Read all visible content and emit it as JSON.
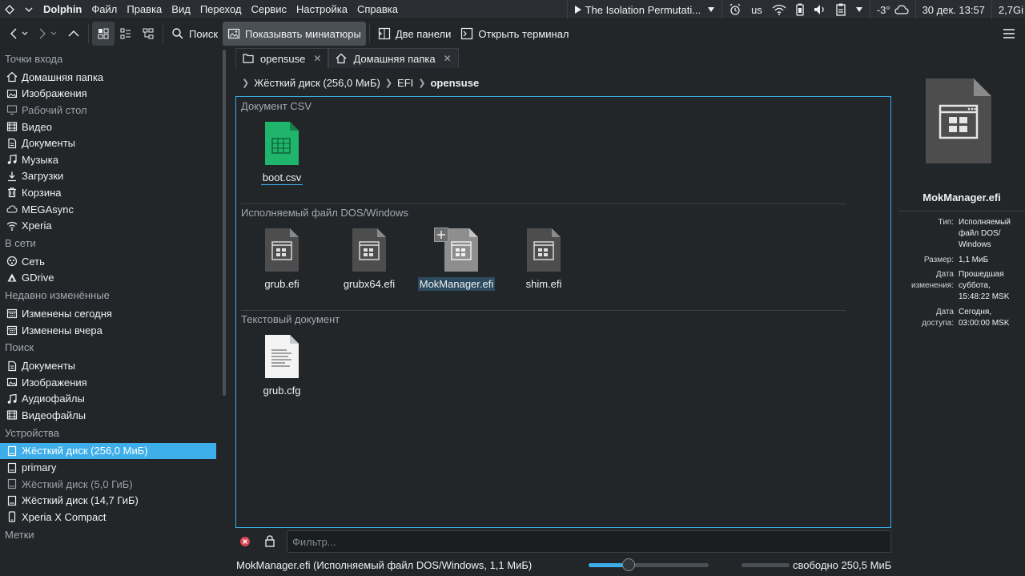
{
  "topbar": {
    "app_name": "Dolphin",
    "menu": [
      "Файл",
      "Правка",
      "Вид",
      "Переход",
      "Сервис",
      "Настройка",
      "Справка"
    ],
    "media_title": "The Isolation Permutati...",
    "keyboard_layout": "us",
    "temperature": "-3°",
    "datetime": "30 дек. 13:57",
    "memory": "2,7Gi"
  },
  "toolbar": {
    "search_label": "Поиск",
    "thumbnails_label": "Показывать миниатюры",
    "split_label": "Две панели",
    "terminal_label": "Открыть терминал"
  },
  "sidebar": {
    "sections": [
      {
        "title": "Точки входа",
        "items": [
          {
            "label": "Домашняя папка",
            "icon": "home-icon"
          },
          {
            "label": "Изображения",
            "icon": "image-icon"
          },
          {
            "label": "Рабочий стол",
            "icon": "desktop-icon",
            "dim": true
          },
          {
            "label": "Видео",
            "icon": "video-icon"
          },
          {
            "label": "Документы",
            "icon": "document-icon"
          },
          {
            "label": "Музыка",
            "icon": "music-icon"
          },
          {
            "label": "Загрузки",
            "icon": "download-icon"
          },
          {
            "label": "Корзина",
            "icon": "trash-icon"
          },
          {
            "label": "MEGAsync",
            "icon": "cloud-icon"
          },
          {
            "label": "Xperia",
            "icon": "wifi-icon"
          }
        ]
      },
      {
        "title": "В сети",
        "items": [
          {
            "label": "Сеть",
            "icon": "network-icon"
          },
          {
            "label": "GDrive",
            "icon": "gdrive-icon"
          }
        ]
      },
      {
        "title": "Недавно изменённые",
        "items": [
          {
            "label": "Изменены сегодня",
            "icon": "calendar-icon"
          },
          {
            "label": "Изменены вчера",
            "icon": "calendar-icon"
          }
        ]
      },
      {
        "title": "Поиск",
        "items": [
          {
            "label": "Документы",
            "icon": "document-icon"
          },
          {
            "label": "Изображения",
            "icon": "image-icon"
          },
          {
            "label": "Аудиофайлы",
            "icon": "music-icon"
          },
          {
            "label": "Видеофайлы",
            "icon": "video-icon"
          }
        ]
      },
      {
        "title": "Устройства",
        "items": [
          {
            "label": "Жёсткий диск (256,0 МиБ)",
            "icon": "drive-icon",
            "selected": true
          },
          {
            "label": "primary",
            "icon": "drive-icon"
          },
          {
            "label": "Жёсткий диск (5,0 ГиБ)",
            "icon": "drive-icon",
            "dim": true
          },
          {
            "label": "Жёсткий диск (14,7 ГиБ)",
            "icon": "drive-icon"
          },
          {
            "label": "Xperia X Compact",
            "icon": "phone-icon"
          }
        ]
      },
      {
        "title": "Метки",
        "items": []
      }
    ]
  },
  "tabs": [
    {
      "label": "opensuse",
      "icon": "folder-icon",
      "active": true
    },
    {
      "label": "Домашняя папка",
      "icon": "home-icon",
      "active": false
    }
  ],
  "breadcrumb": [
    "Жёсткий диск (256,0 МиБ)",
    "EFI",
    "opensuse"
  ],
  "view": {
    "groups": [
      {
        "title": "Документ CSV",
        "files": [
          {
            "name": "boot.csv",
            "type": "csv"
          }
        ]
      },
      {
        "title": "Исполняемый файл DOS/Windows",
        "files": [
          {
            "name": "grub.efi",
            "type": "exe"
          },
          {
            "name": "grubx64.efi",
            "type": "exe"
          },
          {
            "name": "MokManager.efi",
            "type": "exe",
            "selected": true
          },
          {
            "name": "shim.efi",
            "type": "exe"
          }
        ]
      },
      {
        "title": "Текстовый документ",
        "files": [
          {
            "name": "grub.cfg",
            "type": "text"
          }
        ]
      }
    ]
  },
  "info": {
    "name": "MokManager.efi",
    "rows": [
      {
        "key": "Тип:",
        "lines": [
          "Исполняемый",
          "файл DOS/",
          "Windows"
        ]
      },
      {
        "key": "Размер:",
        "lines": [
          "1,1 МиБ"
        ]
      },
      {
        "key_lines": [
          "Дата",
          "изменения:"
        ],
        "lines": [
          "Прошедшая",
          "суббота,",
          "15:48:22 MSK"
        ]
      },
      {
        "key_lines": [
          "Дата",
          "доступа:"
        ],
        "lines": [
          "Сегодня,",
          "03:00:00 MSK"
        ]
      }
    ]
  },
  "filter": {
    "placeholder": "Фильтр..."
  },
  "statusbar": {
    "text": "MokManager.efi (Исполняемый файл DOS/Windows, 1,1 МиБ)",
    "free_space": "свободно 250,5 МиБ",
    "zoom_fraction": 0.33
  },
  "colors": {
    "accent": "#3daee9",
    "background": "#232629",
    "csv_green": "#1fb56b"
  }
}
